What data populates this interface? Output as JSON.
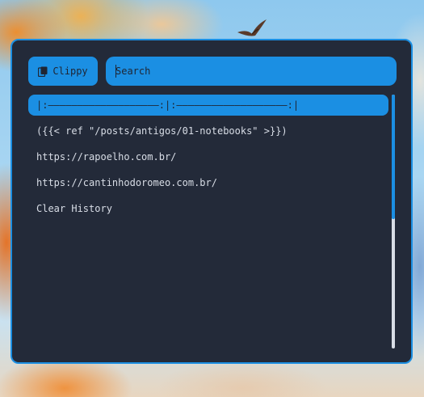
{
  "launcher": {
    "mode_label": "Clippy",
    "mode_icon": "clipboard-icon",
    "search_placeholder": "Search",
    "search_value": "",
    "items": [
      "|:———————————————————:|:———————————————————:|",
      "({{< ref \"/posts/antigos/01-notebooks\" >}})",
      "https://rapoelho.com.br/",
      "https://cantinhodoromeo.com.br/",
      "Clear History"
    ],
    "selected_index": 0,
    "scroll_position": 0.0,
    "scroll_visible_fraction": 0.49
  },
  "colors": {
    "accent": "#1b8fe3",
    "panel_bg": "#232a39",
    "text": "#d8dde6",
    "selected_text": "#1f2533"
  }
}
